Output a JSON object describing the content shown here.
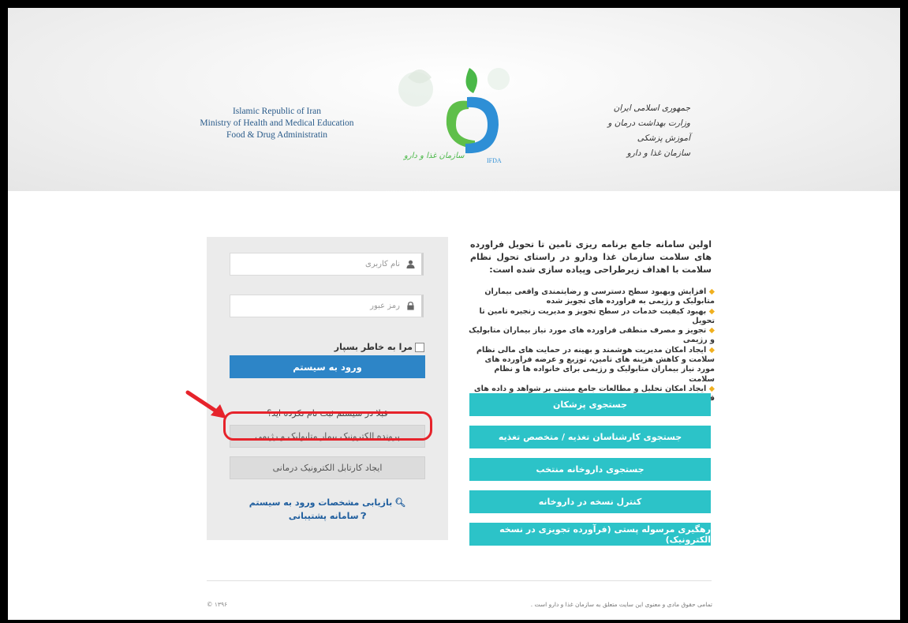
{
  "header": {
    "en_lines": [
      "Islamic Republic of Iran",
      "Ministry of Health and Medical Education",
      "Food & Drug Administratin"
    ],
    "fa_lines": [
      "جمهوری اسلامی ایران",
      "وزارت بهداشت درمان و آموزش پزشکی",
      "سازمان غذا و دارو"
    ],
    "logo_text_fa": "سازمان غذا و دارو",
    "logo_text_en": "IFDA"
  },
  "login": {
    "username_placeholder": "نام کاربری",
    "password_placeholder": "رمز عبور",
    "remember_label": "مرا به خاطر بسپار",
    "login_button": "ورود به سیستم",
    "not_registered": "قبلا در سیستم ثبت نام نکرده اید؟",
    "ehr_button": "پرونده الکترونیک بیمار متابولیک و رژیمی",
    "create_ehr_button": "ایجاد کارتابل الکترونیک درمانی",
    "recover_link": "بازیابی مشخصات ورود به سیستم",
    "support_link": "سامانه پشتیبانی"
  },
  "intro": {
    "text": "اولین سامانه جامع برنامه ریزی تامین تا تحویل فراورده های سلامت سازمان غذا ودارو در راستای تحول نظام سلامت با اهداف زیرطراحی وپیاده سازی شده است:",
    "bullets": [
      "افزایش وبهبود سطح دسترسی و رضایتمندی واقعی بیماران متابولیک و رژیمی به فراورده های تجویز شده",
      "بهبود کیفیت خدمات در سطح تجویز و مدیریت زنجیره تامین تا تحویل",
      "تجویز و مصرف منطقی فراورده های مورد نیاز بیماران متابولیک و رژیمی",
      "ایجاد امکان مدیریت هوشمند و بهینه در حمایت های مالی نظام سلامت و کاهش هزینه های تامین، توزیع و عرضه فراورده های مورد نیاز بیماران متابولیک و رژیمی برای خانواده ها و نظام سلامت",
      "ایجاد امکان تحلیل و مطالعات جامع مبتنی بر شواهد و داده های قابل اتکا"
    ]
  },
  "actions": {
    "search_doctors": "جستجوی پزشکان",
    "search_nutritionists": "جستجوی کارشناسان تغذیه / متخصص تغذیه",
    "search_pharmacy": "جستجوی داروخانه منتخب",
    "check_prescription": "کنترل نسخه در داروخانه",
    "track_parcel": "رهگیری مرسوله پستی (فرآورده تجویزی در نسخه الکترونیک)"
  },
  "footer": {
    "rights": "تمامی حقوق مادی و معنوی این سایت متعلق به سازمان غذا و دارو است .",
    "year": "۱۳۹۶ ©"
  },
  "colors": {
    "primary": "#2d85c7",
    "teal": "#2cc3c8",
    "highlight": "#e6232b",
    "panel": "#ebebeb"
  }
}
